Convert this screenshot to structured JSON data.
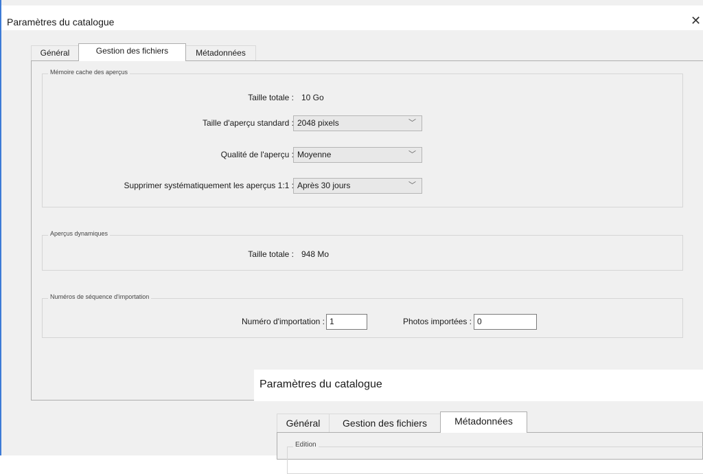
{
  "dialog": {
    "title": "Paramètres du catalogue",
    "close_glyph": "✕",
    "tabs": [
      {
        "label": "Général"
      },
      {
        "label": "Gestion des fichiers"
      },
      {
        "label": "Métadonnées"
      }
    ],
    "active_tab": "Gestion des fichiers",
    "preview_cache": {
      "title": "Mémoire cache des aperçus",
      "total_size_label": "Taille totale :",
      "total_size_value": "10 Go",
      "standard_size_label": "Taille d'aperçu standard :",
      "standard_size_value": "2048 pixels",
      "quality_label": "Qualité de l'aperçu :",
      "quality_value": "Moyenne",
      "discard_label": "Supprimer systématiquement les aperçus 1:1 :",
      "discard_value": "Après 30 jours"
    },
    "smart_previews": {
      "title": "Aperçus dynamiques",
      "total_size_label": "Taille totale :",
      "total_size_value": "948 Mo"
    },
    "import_sequence": {
      "title": "Numéros de séquence d'importation",
      "import_number_label": "Numéro d'importation :",
      "import_number_value": "1",
      "photos_imported_label": "Photos importées :",
      "photos_imported_value": "0"
    }
  },
  "dialog2": {
    "title": "Paramètres du catalogue",
    "tabs": [
      {
        "label": "Général"
      },
      {
        "label": "Gestion des fichiers"
      },
      {
        "label": "Métadonnées"
      }
    ],
    "active_tab": "Métadonnées",
    "group_title": "Edition"
  },
  "colors": {
    "accent_border": "#3d7bd6",
    "dialog_bg": "#f0f0f0",
    "titlebar_bg": "#ffffff"
  }
}
